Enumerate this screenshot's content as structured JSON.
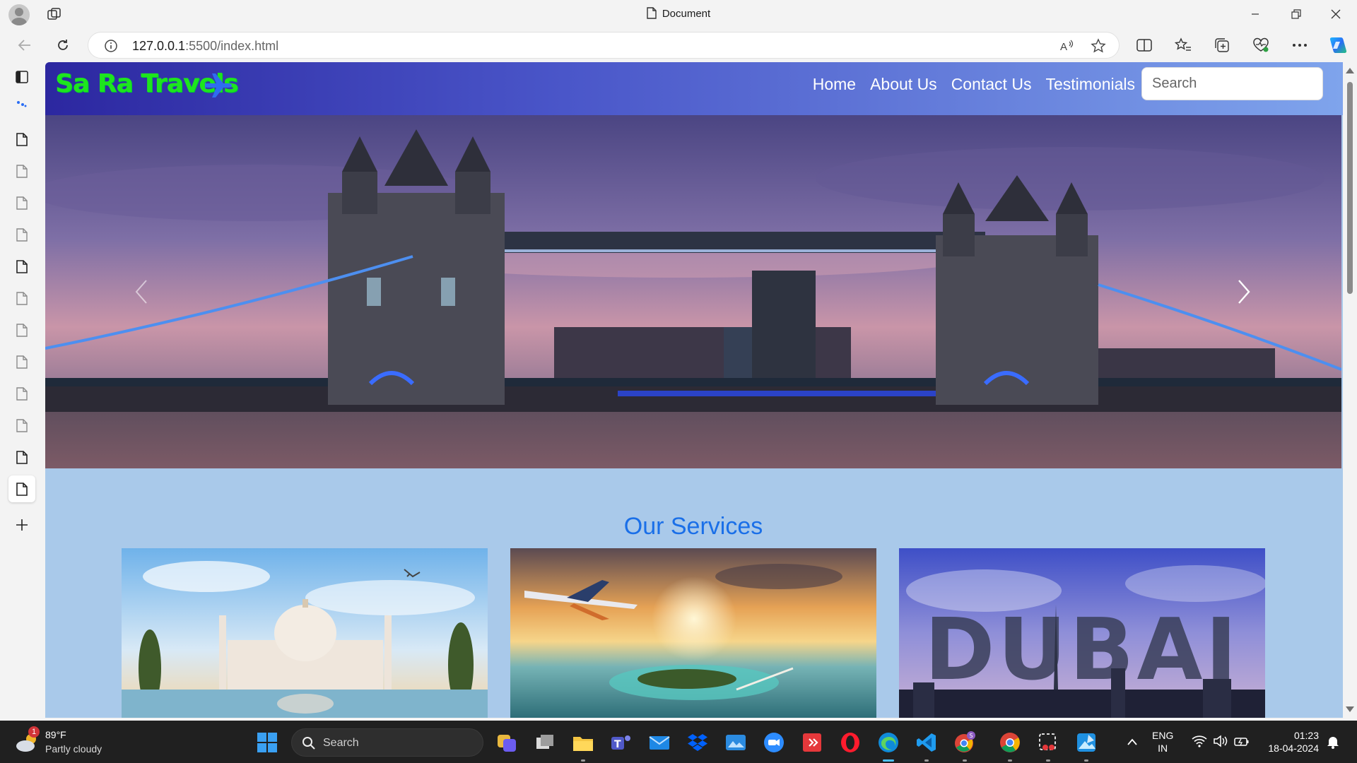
{
  "browser": {
    "tab_title": "Document",
    "url_host": "127.0.0.1",
    "url_rest": ":5500/index.html"
  },
  "site": {
    "brand": "Sa Ra Travels",
    "nav": [
      "Home",
      "About Us",
      "Contact Us",
      "Testimonials"
    ],
    "search_placeholder": "Search",
    "services_title": "Our Services",
    "card3_overlay": "DUBAI"
  },
  "taskbar": {
    "weather_badge": "1",
    "weather_temp": "89°F",
    "weather_cond": "Partly cloudy",
    "search_label": "Search",
    "lang_top": "ENG",
    "lang_bottom": "IN",
    "time": "01:23",
    "date": "18-04-2024"
  },
  "colors": {
    "brand_text": "#1ee51e",
    "nav_gradient_start": "#2c27a0",
    "nav_gradient_end": "#7fa4ec",
    "page_bg": "#a9c9ea",
    "services_title": "#1a6fe8"
  }
}
